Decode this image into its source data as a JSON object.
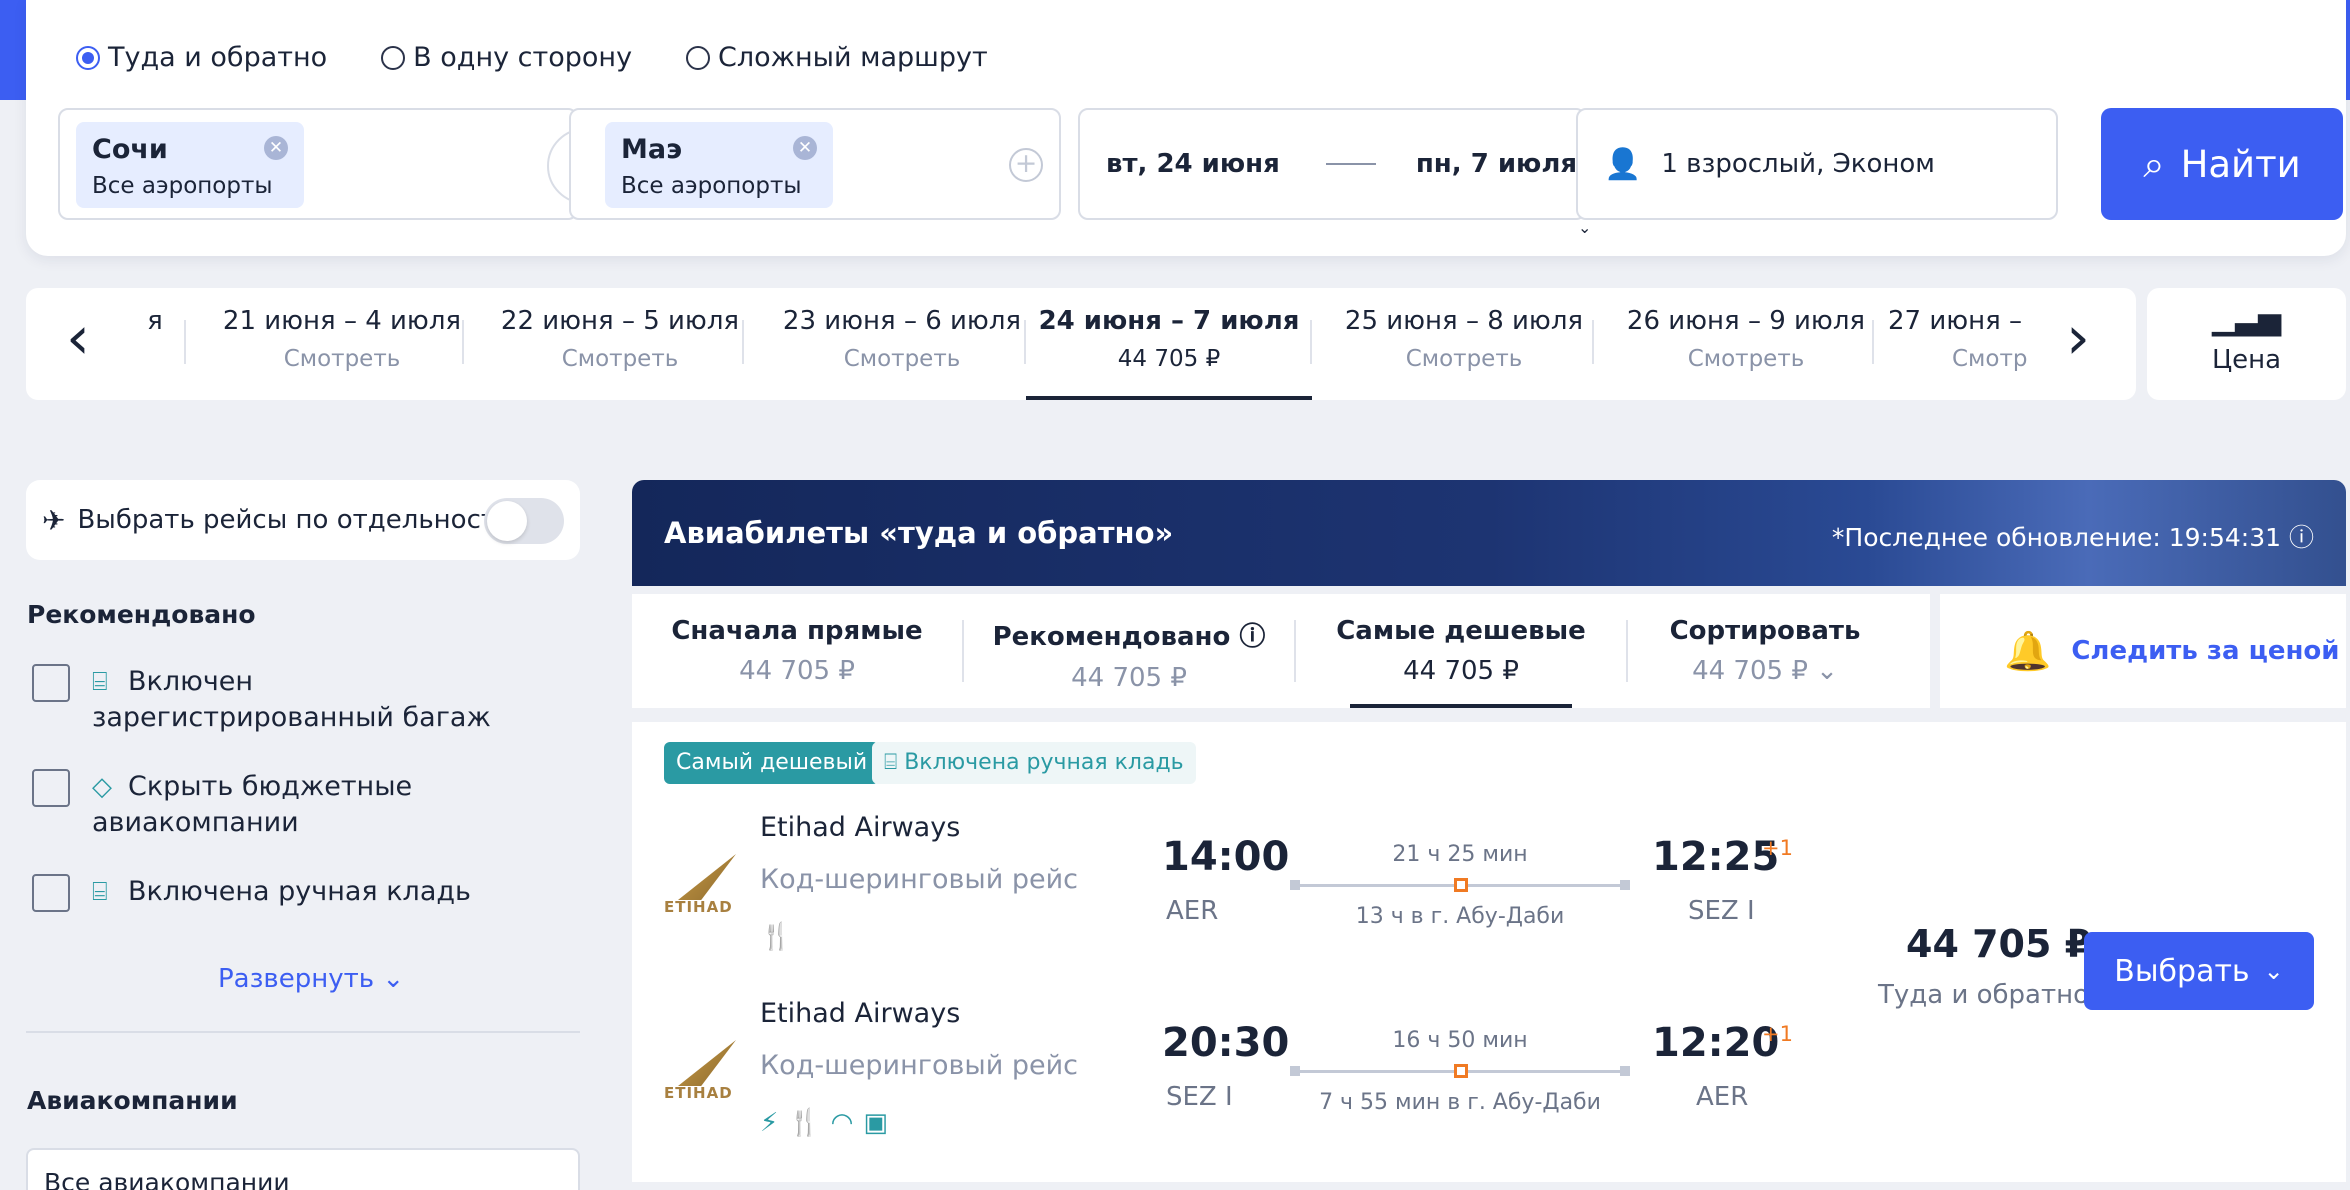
{
  "search": {
    "trip_types": [
      {
        "label": "Туда и обратно",
        "selected": true
      },
      {
        "label": "В одну сторону",
        "selected": false
      },
      {
        "label": "Сложный маршрут",
        "selected": false
      }
    ],
    "origin": {
      "city": "Сочи",
      "sub": "Все аэропорты"
    },
    "destination": {
      "city": "Маэ",
      "sub": "Все аэропорты"
    },
    "depart_date": "вт, 24 июня",
    "return_date": "пн, 7 июля",
    "passengers": "1 взрослый, Эконом",
    "find_label": "Найти"
  },
  "date_strip": {
    "items": [
      {
        "range": "я",
        "sub": ""
      },
      {
        "range": "21 июня – 4 июля",
        "sub": "Смотреть"
      },
      {
        "range": "22 июня – 5 июля",
        "sub": "Смотреть"
      },
      {
        "range": "23 июня – 6 июля",
        "sub": "Смотреть"
      },
      {
        "range": "24 июня – 7 июля",
        "sub": "44 705 ₽"
      },
      {
        "range": "25 июня – 8 июля",
        "sub": "Смотреть"
      },
      {
        "range": "26 июня – 9 июля",
        "sub": "Смотреть"
      },
      {
        "range": "27 июня –",
        "sub": "Смотр"
      }
    ],
    "price_label": "Цена"
  },
  "sidebar": {
    "toggle_label": "Выбрать рейсы по отдельности",
    "recommended_title": "Рекомендовано",
    "filters": [
      {
        "label": "Включен зарегистрированный багаж"
      },
      {
        "label": "Скрыть бюджетные авиакомпании"
      },
      {
        "label": "Включена ручная кладь"
      }
    ],
    "expand_label": "Развернуть",
    "airlines_title": "Авиакомпании",
    "airlines_value": "Все авиакомпании"
  },
  "results": {
    "title": "Авиабилеты «туда и обратно»",
    "updated": "*Последнее обновление: 19:54:31",
    "sort_tabs": [
      {
        "label": "Сначала прямые",
        "price": "44 705 ₽"
      },
      {
        "label": "Рекомендовано",
        "price": "44 705 ₽"
      },
      {
        "label": "Самые дешевые",
        "price": "44 705 ₽"
      },
      {
        "label": "Сортировать",
        "price": "44 705 ₽"
      }
    ],
    "watch_label": "Следить за ценой",
    "ticket": {
      "badge_cheapest": "Самый дешевый",
      "badge_hand": "Включена ручная кладь",
      "segments": [
        {
          "airline": "Etihad Airways",
          "logo_text": "ETIHAD",
          "codeshare": "Код-шеринговый рейс",
          "dep_time": "14:00",
          "dep_code": "AER",
          "duration": "21 ч 25 мин",
          "layover": "13 ч в г. Абу-Даби",
          "arr_time": "12:25",
          "arr_plus": "+1",
          "arr_code": "SEZ I"
        },
        {
          "airline": "Etihad Airways",
          "logo_text": "ETIHAD",
          "codeshare": "Код-шеринговый рейс",
          "dep_time": "20:30",
          "dep_code": "SEZ I",
          "duration": "16 ч 50 мин",
          "layover": "7 ч 55 мин в г. Абу-Даби",
          "arr_time": "12:20",
          "arr_plus": "+1",
          "arr_code": "AER"
        }
      ],
      "price": "44 705 ₽",
      "price_note": "Туда и обратно",
      "select_label": "Выбрать"
    }
  }
}
